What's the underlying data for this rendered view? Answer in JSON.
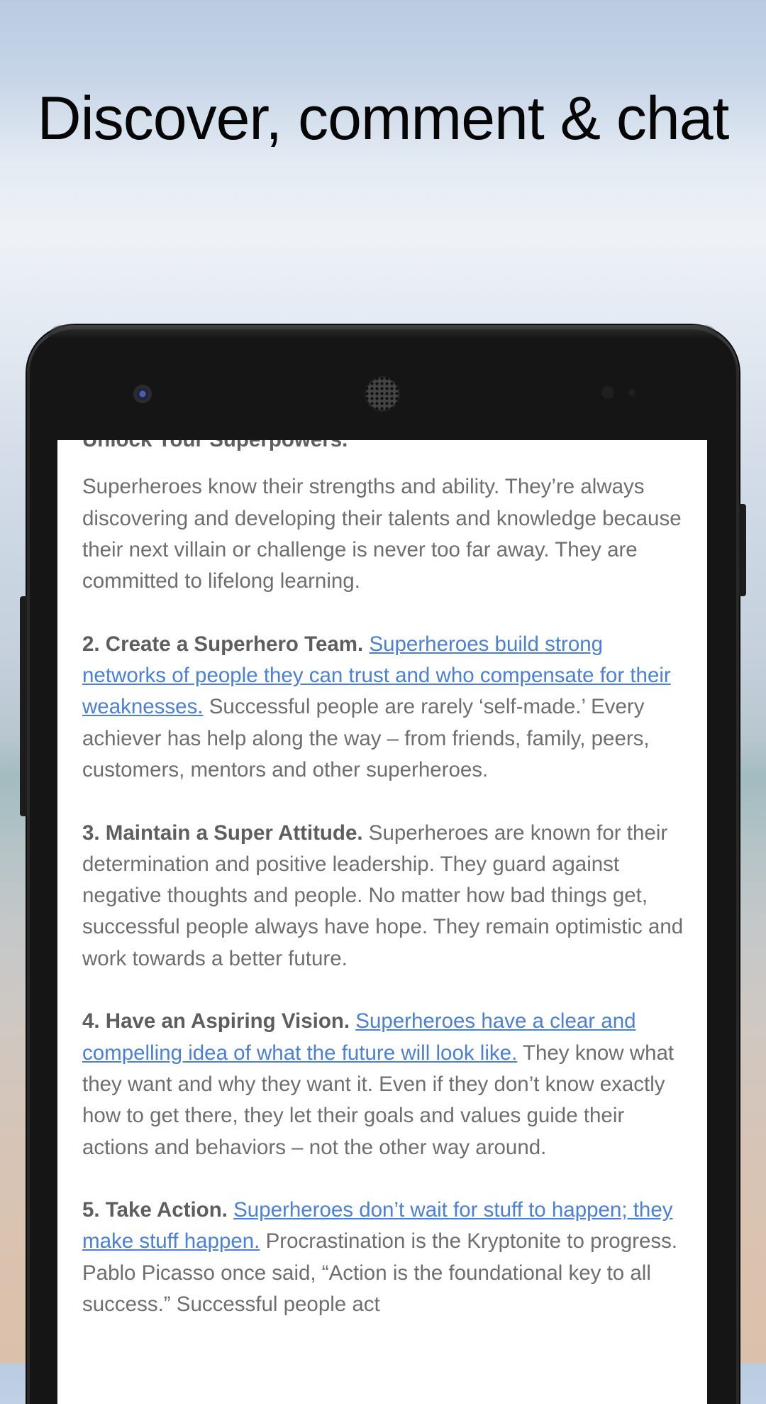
{
  "headline": "Discover, comment & chat",
  "article": {
    "partial_heading": "Unlock Your Superpowers.",
    "paragraphs": [
      {
        "lead": "",
        "link": "",
        "text": "Superheroes know their strengths and ability. They’re always discovering and developing their talents and knowledge because their next villain or challenge is never too far away. They are committed to lifelong learning."
      },
      {
        "lead": "2. Create a Superhero Team.",
        "link": "Superheroes build strong networks of people they can trust and who compensate for their weaknesses.",
        "text": "Successful people are rarely ‘self-made.’ Every achiever has help along the way – from friends, family, peers, customers, mentors and other superheroes."
      },
      {
        "lead": "3. Maintain a Super Attitude.",
        "link": "",
        "text": "Superheroes are known for their determination and positive leadership. They guard against negative thoughts and people. No matter how bad things get, successful people always have hope. They remain optimistic and work towards a better future."
      },
      {
        "lead": "4. Have an Aspiring Vision.",
        "link": "Superheroes have a clear and compelling idea of what the future will look like.",
        "text": "They know what they want and why they want it. Even if they don’t know exactly how to get there, they let their goals and values guide their actions and behaviors – not the other way around."
      },
      {
        "lead": "5. Take Action.",
        "link": "Superheroes don’t wait for stuff to happen; they make stuff happen.",
        "text": "Procrastination is the Kryptonite to progress. Pablo Picasso once said, “Action is the foundational key to all success.” Successful people act"
      }
    ]
  },
  "colors": {
    "link": "#4a80d6",
    "body_text": "#6e6e6e",
    "phone_body": "#151515"
  },
  "icons": {
    "front_camera": "front-camera-icon",
    "speaker": "earpiece-speaker-icon"
  }
}
